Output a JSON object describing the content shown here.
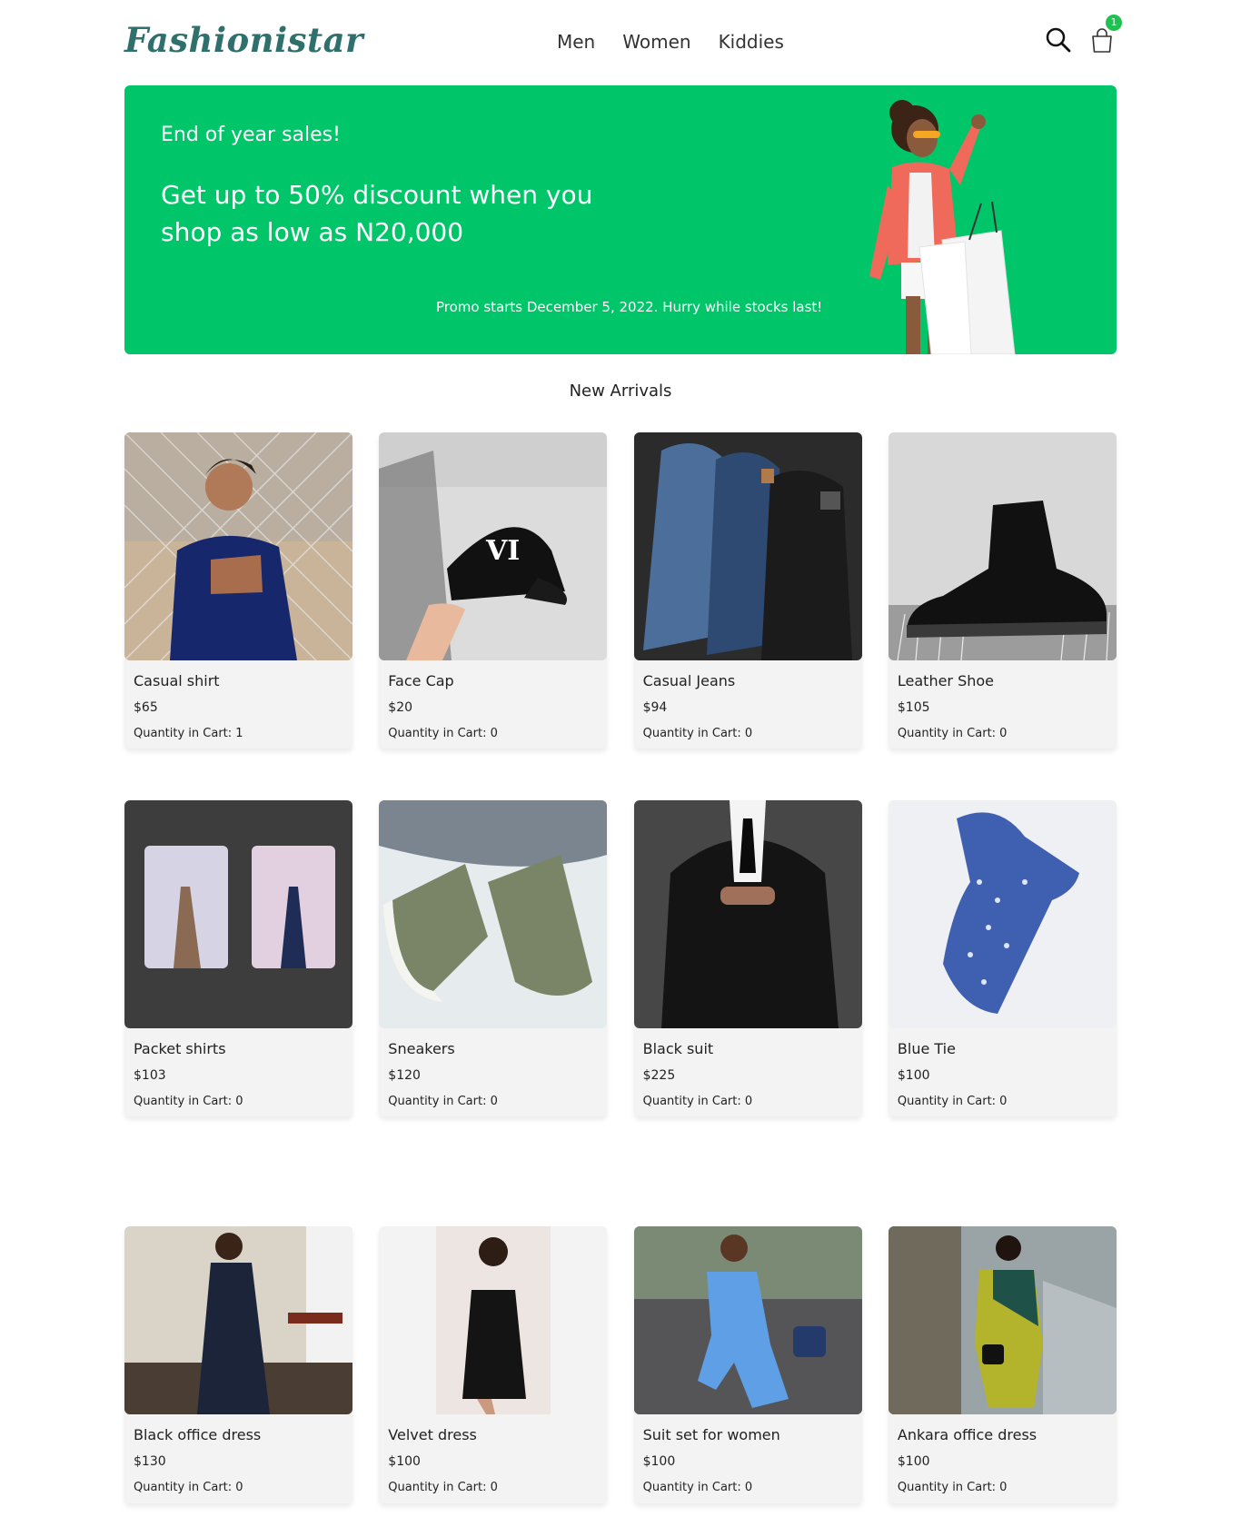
{
  "brand": {
    "logo_text": "Fashionistar",
    "accent": "#00c569",
    "logo_color": "#2f6f6c"
  },
  "nav": {
    "items": [
      "Men",
      "Women",
      "Kiddies"
    ]
  },
  "cart": {
    "count": "1"
  },
  "icons": {
    "search": "search-icon",
    "cart": "shopping-bag-icon"
  },
  "banner": {
    "kicker": "End of year sales!",
    "headline": "Get up to 50% discount when you shop as low as N20,000",
    "note": "Promo starts December 5, 2022. Hurry while stocks last!"
  },
  "section": {
    "title": "New Arrivals"
  },
  "products": [
    {
      "name": "Casual shirt",
      "price": "$65",
      "qty": "Quantity in Cart: 1"
    },
    {
      "name": "Face Cap",
      "price": "$20",
      "qty": "Quantity in Cart: 0"
    },
    {
      "name": "Casual Jeans",
      "price": "$94",
      "qty": "Quantity in Cart: 0"
    },
    {
      "name": "Leather Shoe",
      "price": "$105",
      "qty": "Quantity in Cart: 0"
    },
    {
      "name": "Packet shirts",
      "price": "$103",
      "qty": "Quantity in Cart: 0"
    },
    {
      "name": "Sneakers",
      "price": "$120",
      "qty": "Quantity in Cart: 0"
    },
    {
      "name": "Black suit",
      "price": "$225",
      "qty": "Quantity in Cart: 0"
    },
    {
      "name": "Blue Tie",
      "price": "$100",
      "qty": "Quantity in Cart: 0"
    },
    {
      "name": "Black office dress",
      "price": "$130",
      "qty": "Quantity in Cart: 0"
    },
    {
      "name": "Velvet dress",
      "price": "$100",
      "qty": "Quantity in Cart: 0"
    },
    {
      "name": "Suit set for women",
      "price": "$100",
      "qty": "Quantity in Cart: 0"
    },
    {
      "name": "Ankara office dress",
      "price": "$100",
      "qty": "Quantity in Cart: 0"
    }
  ]
}
